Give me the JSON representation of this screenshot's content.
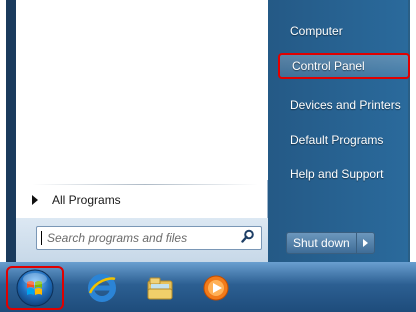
{
  "start_menu": {
    "left": {
      "all_programs": "All Programs",
      "search": {
        "placeholder": "Search programs and files"
      }
    },
    "right": {
      "items": [
        {
          "label": "Computer",
          "highlight": false
        },
        {
          "label": "Control Panel",
          "highlight": true
        },
        {
          "label": "Devices and Printers",
          "highlight": false
        },
        {
          "label": "Default Programs",
          "highlight": false
        },
        {
          "label": "Help and Support",
          "highlight": false
        }
      ],
      "shutdown_label": "Shut down"
    }
  },
  "taskbar": {
    "pinned": [
      {
        "icon": "internet-explorer-icon"
      },
      {
        "icon": "windows-explorer-folder-icon"
      },
      {
        "icon": "media-player-icon"
      }
    ]
  },
  "colors": {
    "highlight_outline": "#e00000",
    "menu_blue": "#2a6a9c",
    "taskbar_blue": "#2c5f92"
  }
}
